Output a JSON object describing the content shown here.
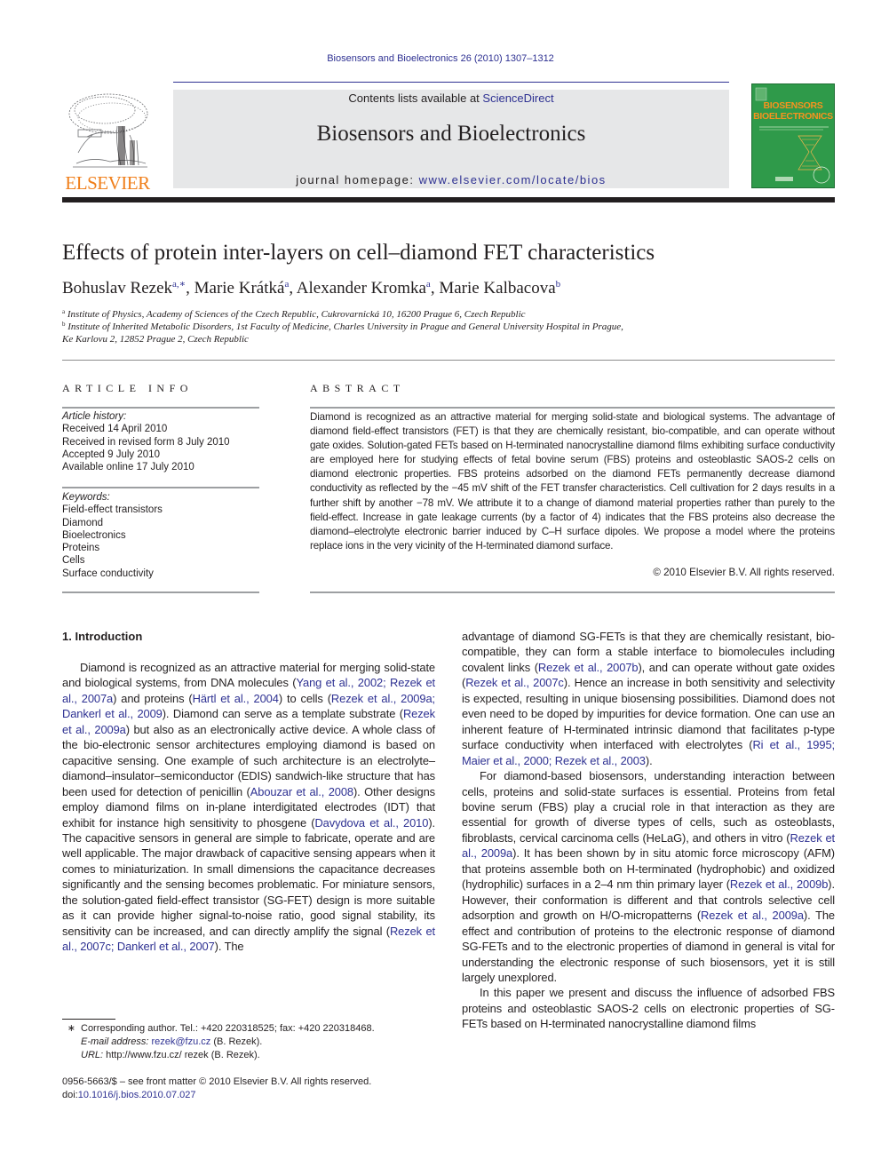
{
  "header": {
    "journal_ref": "Biosensors and Bioelectronics 26 (2010) 1307–1312",
    "contents_prefix": "Contents lists available at ",
    "contents_link": "ScienceDirect",
    "journal_title": "Biosensors and Bioelectronics",
    "homepage_prefix": "journal homepage: ",
    "homepage_link": "www.elsevier.com/locate/bios",
    "publisher_logo": "ELSEVIER",
    "cover": {
      "line1": "BIOSENSORS",
      "line2": "BIOELECTRONICS"
    },
    "colors": {
      "link": "#2e3192",
      "elsevier_orange": "#f07f1b",
      "cover_green": "#2f9a4a",
      "banner_gray": "#e6e7e8"
    }
  },
  "article": {
    "title": "Effects of protein inter-layers on cell–diamond FET characteristics",
    "authors": [
      {
        "name": "Bohuslav Rezek",
        "sup": "a,∗"
      },
      {
        "name": "Marie Krátká",
        "sup": "a"
      },
      {
        "name": "Alexander Kromka",
        "sup": "a"
      },
      {
        "name": "Marie Kalbacova",
        "sup": "b"
      }
    ],
    "affiliations": [
      {
        "sup": "a",
        "text": "Institute of Physics, Academy of Sciences of the Czech Republic, Cukrovarnická 10, 16200 Prague 6, Czech Republic"
      },
      {
        "sup": "b",
        "text": "Institute of Inherited Metabolic Disorders, 1st Faculty of Medicine, Charles University in Prague and General University Hospital in Prague,",
        "text2": "Ke Karlovu 2, 12852 Prague 2, Czech Republic"
      }
    ]
  },
  "article_info": {
    "heading": "ARTICLE INFO",
    "history_label": "Article history:",
    "history": [
      "Received 14 April 2010",
      "Received in revised form 8 July 2010",
      "Accepted 9 July 2010",
      "Available online 17 July 2010"
    ],
    "keywords_label": "Keywords:",
    "keywords": [
      "Field-effect transistors",
      "Diamond",
      "Bioelectronics",
      "Proteins",
      "Cells",
      "Surface conductivity"
    ]
  },
  "abstract": {
    "heading": "ABSTRACT",
    "text": "Diamond is recognized as an attractive material for merging solid-state and biological systems. The advantage of diamond field-effect transistors (FET) is that they are chemically resistant, bio-compatible, and can operate without gate oxides. Solution-gated FETs based on H-terminated nanocrystalline diamond films exhibiting surface conductivity are employed here for studying effects of fetal bovine serum (FBS) proteins and osteoblastic SAOS-2 cells on diamond electronic properties. FBS proteins adsorbed on the diamond FETs permanently decrease diamond conductivity as reflected by the −45 mV shift of the FET transfer characteristics. Cell cultivation for 2 days results in a further shift by another −78 mV. We attribute it to a change of diamond material properties rather than purely to the field-effect. Increase in gate leakage currents (by a factor of 4) indicates that the FBS proteins also decrease the diamond–electrolyte electronic barrier induced by C–H surface dipoles. We propose a model where the proteins replace ions in the very vicinity of the H-terminated diamond surface.",
    "copyright": "© 2010 Elsevier B.V. All rights reserved."
  },
  "body": {
    "section_heading": "1.  Introduction",
    "left_paragraph": [
      {
        "t": "Diamond is recognized as an attractive material for merging solid-state and biological systems, from DNA molecules ("
      },
      {
        "l": "Yang et al., 2002; Rezek et al., 2007a"
      },
      {
        "t": ") and proteins ("
      },
      {
        "l": "Härtl et al., 2004"
      },
      {
        "t": ") to cells ("
      },
      {
        "l": "Rezek et al., 2009a; Dankerl et al., 2009"
      },
      {
        "t": "). Diamond can serve as a template substrate ("
      },
      {
        "l": "Rezek et al., 2009a"
      },
      {
        "t": ") but also as an electronically active device. A whole class of the bio-electronic sensor architectures employing diamond is based on capacitive sensing. One example of such architecture is an electrolyte–diamond–insulator–semiconductor (EDIS) sandwich-like structure that has been used for detection of penicillin ("
      },
      {
        "l": "Abouzar et al., 2008"
      },
      {
        "t": "). Other designs employ diamond films on in-plane interdigitated electrodes (IDT) that exhibit for instance high sensitivity to phosgene ("
      },
      {
        "l": "Davydova et al., 2010"
      },
      {
        "t": "). The capacitive sensors in general are simple to fabricate, operate and are well applicable. The major drawback of capacitive sensing appears when it comes to miniaturization. In small dimensions the capacitance decreases significantly and the sensing becomes problematic. For miniature sensors, the solution-gated field-effect transistor (SG-FET) design is more suitable as it can provide higher signal-to-noise ratio, good signal stability, its sensitivity can be increased, and can directly amplify the signal ("
      },
      {
        "l": "Rezek et al., 2007c; Dankerl et al., 2007"
      },
      {
        "t": "). The"
      }
    ],
    "right_paragraph1": [
      {
        "t": "advantage of diamond SG-FETs is that they are chemically resistant, bio-compatible, they can form a stable interface to biomolecules including covalent links ("
      },
      {
        "l": "Rezek et al., 2007b"
      },
      {
        "t": "), and can operate without gate oxides ("
      },
      {
        "l": "Rezek et al., 2007c"
      },
      {
        "t": "). Hence an increase in both sensitivity and selectivity is expected, resulting in unique biosensing possibilities. Diamond does not even need to be doped by impurities for device formation. One can use an inherent feature of H-terminated intrinsic diamond that facilitates p-type surface conductivity when interfaced with electrolytes ("
      },
      {
        "l": "Ri et al., 1995; Maier et al., 2000; Rezek et al., 2003"
      },
      {
        "t": ")."
      }
    ],
    "right_paragraph2": [
      {
        "t": "For diamond-based biosensors, understanding interaction between cells, proteins and solid-state surfaces is essential. Proteins from fetal bovine serum (FBS) play a crucial role in that interaction as they are essential for growth of diverse types of cells, such as osteoblasts, fibroblasts, cervical carcinoma cells (HeLaG), and others in vitro ("
      },
      {
        "l": "Rezek et al., 2009a"
      },
      {
        "t": "). It has been shown by in situ atomic force microscopy (AFM) that proteins assemble both on H-terminated (hydrophobic) and oxidized (hydrophilic) surfaces in a 2–4 nm thin primary layer ("
      },
      {
        "l": "Rezek et al., 2009b"
      },
      {
        "t": "). However, their conformation is different and that controls selective cell adsorption and growth on H/O-micropatterns ("
      },
      {
        "l": "Rezek et al., 2009a"
      },
      {
        "t": "). The effect and contribution of proteins to the electronic response of diamond SG-FETs and to the electronic properties of diamond in general is vital for understanding the electronic response of such biosensors, yet it is still largely unexplored."
      }
    ],
    "right_paragraph3": [
      {
        "t": "In this paper we present and discuss the influence of adsorbed FBS proteins and osteoblastic SAOS-2 cells on electronic properties of SG-FETs based on H-terminated nanocrystalline diamond films"
      }
    ]
  },
  "footnotes": {
    "star": "∗",
    "corresponding": "Corresponding author. Tel.: +420 220318525; fax: +420 220318468.",
    "email_label": "E-mail address:",
    "email": "rezek@fzu.cz",
    "email_suffix": " (B. Rezek).",
    "url_label": "URL:",
    "url": " http://www.fzu.cz/ rezek (B. Rezek).",
    "front_matter": "0956-5663/$ – see front matter © 2010 Elsevier B.V. All rights reserved.",
    "doi_label": "doi:",
    "doi": "10.1016/j.bios.2010.07.027"
  }
}
